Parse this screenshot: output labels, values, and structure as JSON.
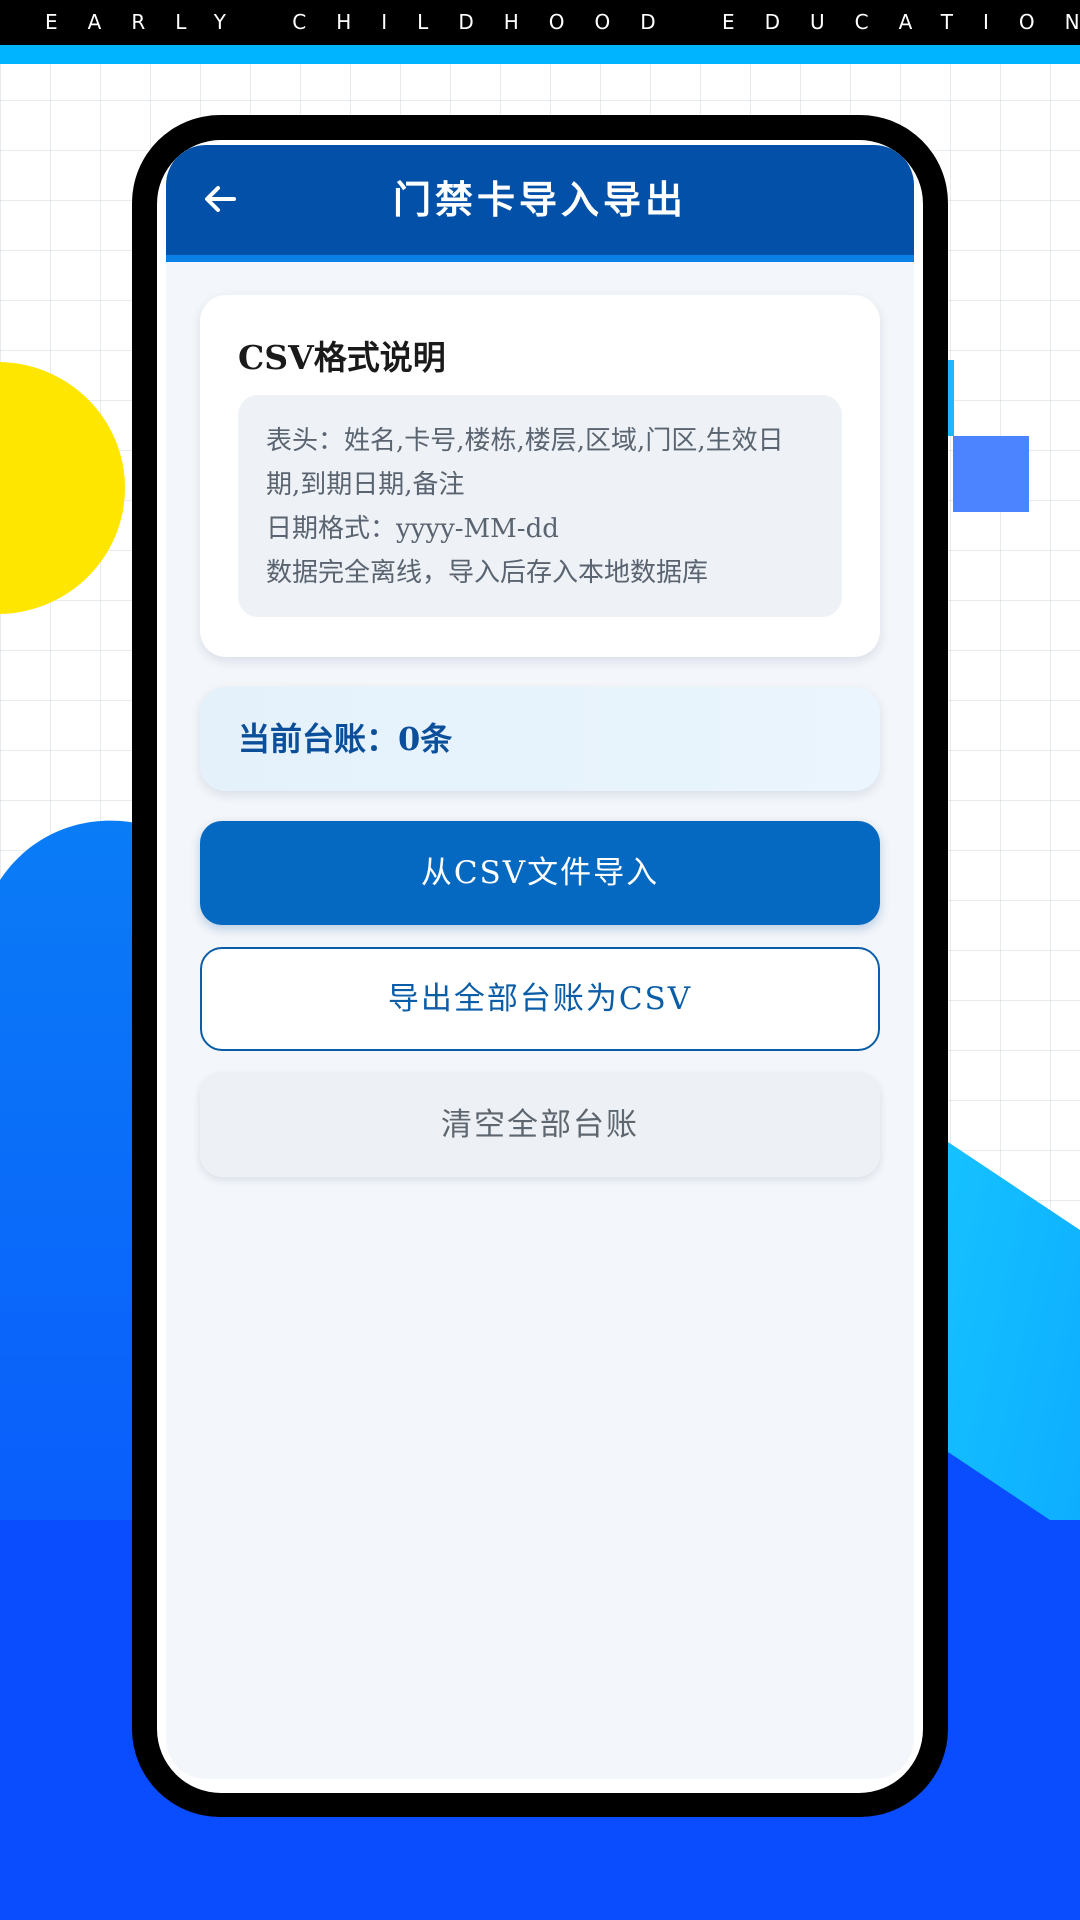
{
  "banner": {
    "text": "EARLY  CHILDHOOD  EDUCATION"
  },
  "appbar": {
    "back_icon": "arrow-left-icon",
    "title": "门禁卡导入导出"
  },
  "info_card": {
    "title": "CSV格式说明",
    "lines": [
      "表头：姓名,卡号,楼栋,楼层,区域,门区,生效日期,到期日期,备注",
      "日期格式：yyyy-MM-dd",
      "数据完全离线，导入后存入本地数据库"
    ]
  },
  "count_card": {
    "text": "当前台账：0条"
  },
  "buttons": {
    "import_label": "从CSV文件导入",
    "export_label": "导出全部台账为CSV",
    "clear_label": "清空全部台账"
  },
  "colors": {
    "appbar": "#0350a8",
    "primary_button": "#0568c1",
    "banner_stripe": "#00b4ff",
    "deco_yellow": "#ffe600",
    "deco_blue": "#0a50ff"
  }
}
